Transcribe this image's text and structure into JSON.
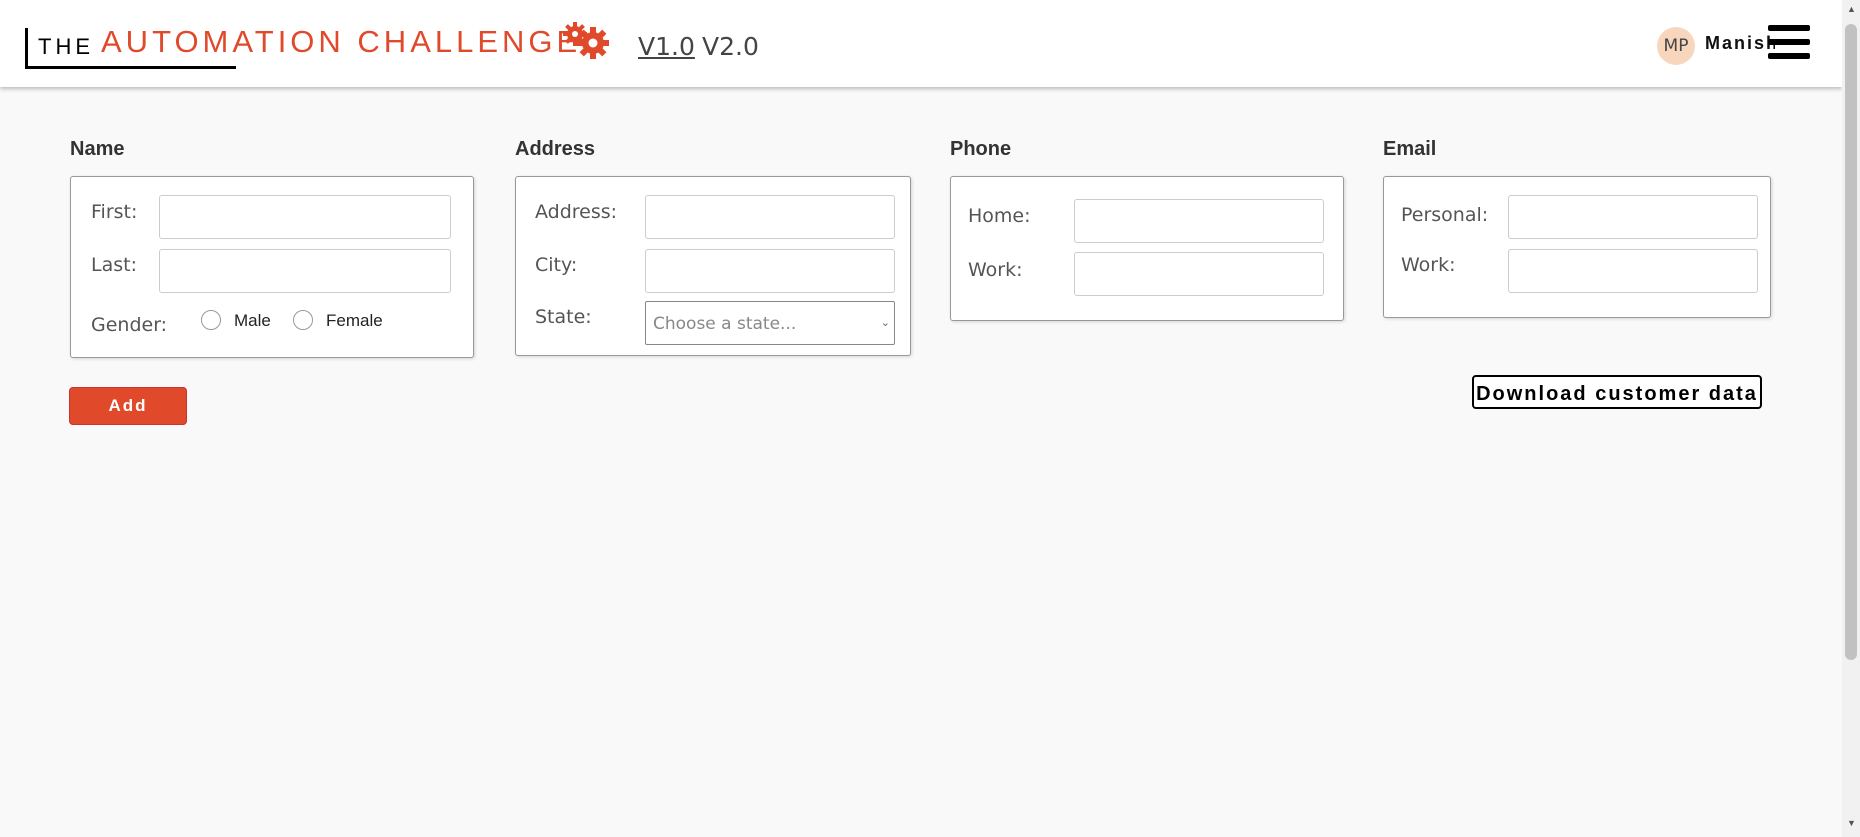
{
  "header": {
    "logo_the": "THE",
    "logo_main": "AUTOMATION CHALLENGE",
    "nav": [
      "V1.0",
      "V2.0"
    ],
    "avatar_initials": "MP",
    "username": "Manish"
  },
  "form": {
    "name": {
      "title": "Name",
      "first_label": "First:",
      "last_label": "Last:",
      "gender_label": "Gender:",
      "gender_options": [
        "Male",
        "Female"
      ]
    },
    "address": {
      "title": "Address",
      "address_label": "Address:",
      "city_label": "City:",
      "state_label": "State:",
      "state_placeholder": "Choose a state..."
    },
    "phone": {
      "title": "Phone",
      "home_label": "Home:",
      "work_label": "Work:"
    },
    "email": {
      "title": "Email",
      "personal_label": "Personal:",
      "work_label": "Work:"
    }
  },
  "actions": {
    "add_label": "Add",
    "download_label": "Download customer data"
  },
  "colors": {
    "accent": "#e04a2b",
    "avatar_bg": "#f8d5bd"
  }
}
